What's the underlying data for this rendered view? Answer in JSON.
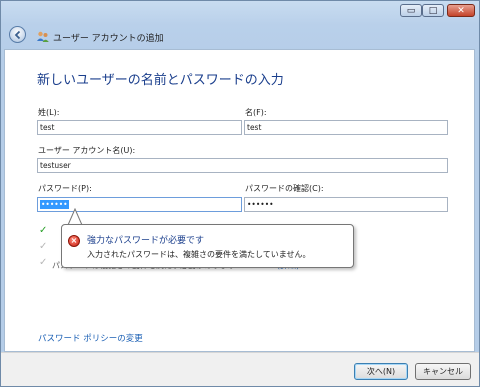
{
  "window": {
    "min_glyph": "▭",
    "max_glyph": "□",
    "close_glyph": "✕"
  },
  "nav": {
    "title": "ユーザー アカウントの追加"
  },
  "form": {
    "heading": "新しいユーザーの名前とパスワードの入力",
    "last_name_label": "姓(L):",
    "last_name_value": "test",
    "first_name_label": "名(F):",
    "first_name_value": "test",
    "account_label": "ユーザー アカウント名(U):",
    "account_value": "testuser",
    "password_label": "パスワード(P):",
    "password_value": "••••••",
    "confirm_label": "パスワードの確認(C):",
    "confirm_value": "••••••",
    "req_tail": "パスワードは複雑さの要件を満たす必要があります",
    "req_link": "(詳細)"
  },
  "tooltip": {
    "title": "強力なパスワードが必要です",
    "message": "入力されたパスワードは、複雑さの要件を満たしていません。"
  },
  "links": {
    "policy": "パスワード ポリシーの変更"
  },
  "footer": {
    "next": "次へ(N)",
    "cancel": "キャンセル"
  },
  "colors": {
    "accent": "#1a3e8c",
    "link": "#1a5fb4",
    "check": "#2aa02a",
    "error": "#c81e10"
  }
}
